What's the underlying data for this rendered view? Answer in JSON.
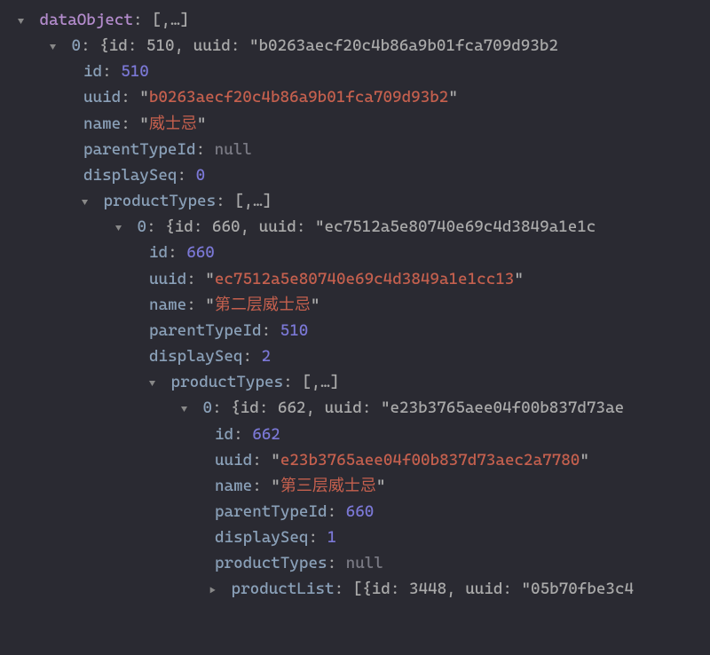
{
  "root": {
    "key": "dataObject",
    "preview": "[,…]",
    "items": [
      {
        "index": "0",
        "summary": "{id: 510, uuid: \"b0263aecf20c4b86a9b01fca709d93b2",
        "fields": {
          "id": "510",
          "uuid": "b0263aecf20c4b86a9b01fca709d93b2",
          "name": "威士忌",
          "parentTypeId": "null",
          "displaySeq": "0"
        },
        "productTypes": {
          "key": "productTypes",
          "preview": "[,…]",
          "items": [
            {
              "index": "0",
              "summary": "{id: 660, uuid: \"ec7512a5e80740e69c4d3849a1e1c",
              "fields": {
                "id": "660",
                "uuid": "ec7512a5e80740e69c4d3849a1e1cc13",
                "name": "第二层威士忌",
                "parentTypeId": "510",
                "displaySeq": "2"
              },
              "productTypes": {
                "key": "productTypes",
                "preview": "[,…]",
                "items": [
                  {
                    "index": "0",
                    "summary": "{id: 662, uuid: \"e23b3765aee04f00b837d73ae",
                    "fields": {
                      "id": "662",
                      "uuid": "e23b3765aee04f00b837d73aec2a7780",
                      "name": "第三层威士忌",
                      "parentTypeId": "660",
                      "displaySeq": "1",
                      "productTypes": "null"
                    },
                    "productList": {
                      "key": "productList",
                      "preview": "[{id: 3448, uuid: \"05b70fbe3c4"
                    }
                  }
                ]
              }
            }
          ]
        }
      }
    ]
  },
  "labels": {
    "id": "id",
    "uuid": "uuid",
    "name": "name",
    "parentTypeId": "parentTypeId",
    "displaySeq": "displaySeq",
    "productTypes": "productTypes",
    "productList": "productList"
  }
}
